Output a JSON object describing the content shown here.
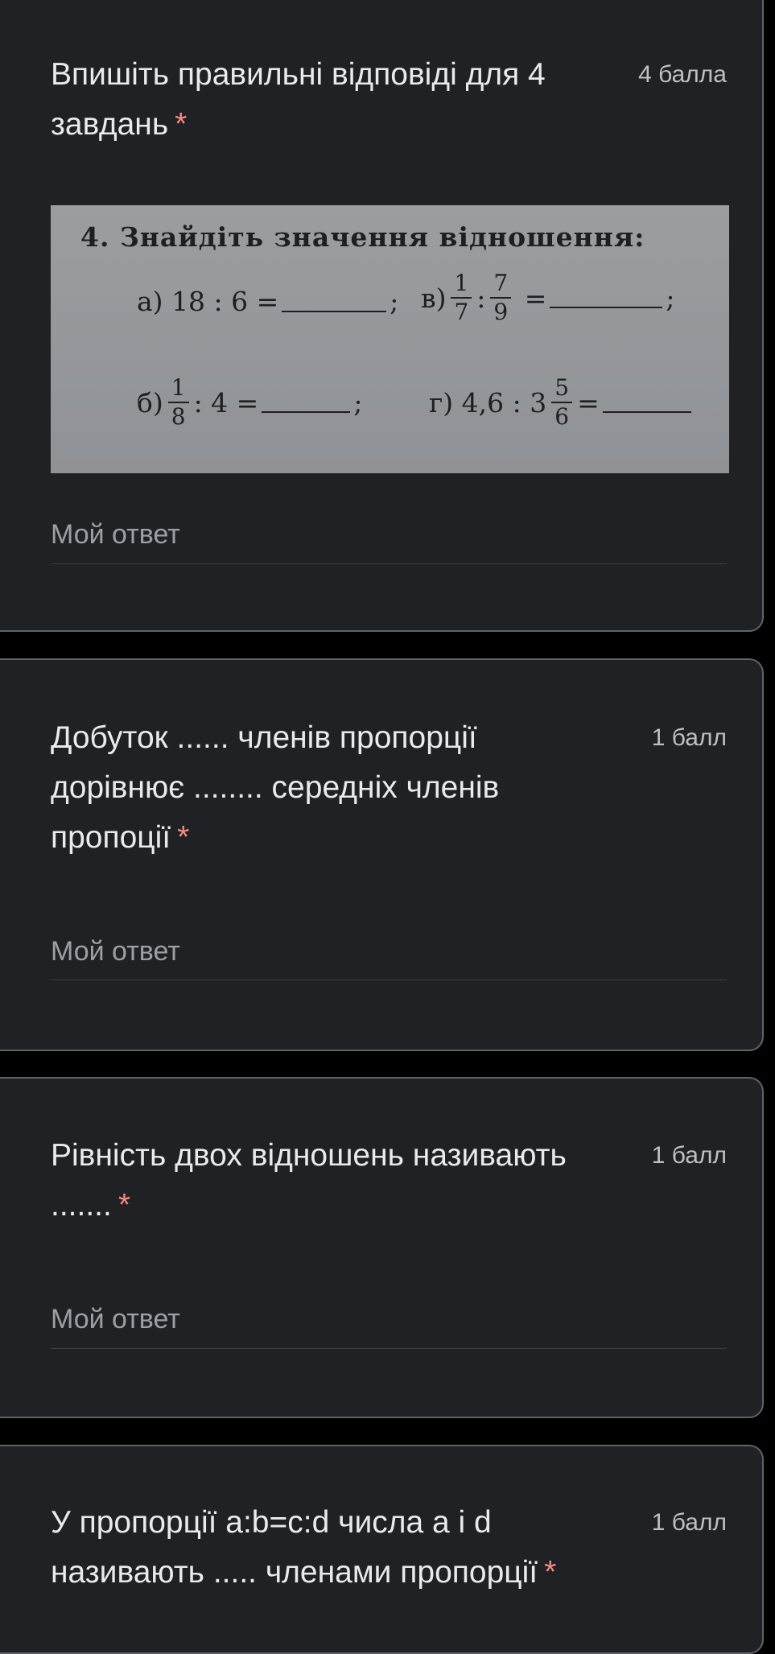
{
  "questions": [
    {
      "title": "Впишіть правильні відповіді для 4 завдань",
      "required_mark": "*",
      "points": "4 балла",
      "answer_placeholder": "Мой ответ"
    },
    {
      "title": "Добуток ...... членів пропорції дорівнює ........ середніх членів пропоції",
      "required_mark": "*",
      "points": "1 балл",
      "answer_placeholder": "Мой ответ"
    },
    {
      "title": "Рівність двох відношень називають .......",
      "required_mark": "*",
      "points": "1 балл",
      "answer_placeholder": "Мой ответ"
    },
    {
      "title": "У пропорції a:b=c:d числа a і d називають ..... членами пропорції",
      "required_mark": "*",
      "points": "1 балл"
    }
  ],
  "task_image": {
    "heading": "4. Знайдіть значення відношення:",
    "a": {
      "label": "а)",
      "expr": "18 : 6 =",
      "end": ";"
    },
    "v": {
      "label": "в)",
      "f1_num": "1",
      "f1_den": "7",
      "sep": ":",
      "f2_num": "7",
      "f2_den": "9",
      "eq": "=",
      "end": ";"
    },
    "b": {
      "label": "б)",
      "f_num": "1",
      "f_den": "8",
      "rest": ": 4 =",
      "end": ";"
    },
    "g": {
      "label": "г)",
      "whole": "4,6 : 3",
      "f_num": "5",
      "f_den": "6",
      "eq": "="
    }
  }
}
